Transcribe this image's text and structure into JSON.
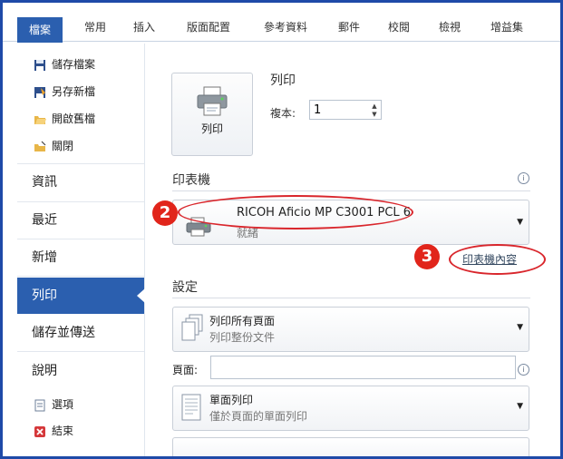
{
  "tabs": [
    "檔案",
    "常用",
    "插入",
    "版面配置",
    "參考資料",
    "郵件",
    "校閱",
    "檢視",
    "增益集"
  ],
  "sidebar": {
    "top_items": [
      "儲存檔案",
      "另存新檔",
      "開啟舊檔",
      "關閉"
    ],
    "big_items": [
      "資訊",
      "最近",
      "新增",
      "列印",
      "儲存並傳送",
      "說明"
    ],
    "bottom_items": [
      "選項",
      "結束"
    ]
  },
  "print": {
    "button_label": "列印",
    "heading": "列印",
    "copies_label": "複本:",
    "copies_value": "1"
  },
  "printer": {
    "section_title": "印表機",
    "name": "RICOH Aficio MP C3001 PCL 6",
    "status": "就緒",
    "properties_link": "印表機內容",
    "info_icon": "i"
  },
  "settings": {
    "section_title": "設定",
    "range_main": "列印所有頁面",
    "range_sub": "列印整份文件",
    "pages_label": "頁面:",
    "sides_main": "單面列印",
    "sides_sub": "僅於頁面的單面列印",
    "info_icon": "i"
  },
  "annotations": {
    "badge2": "2",
    "badge3": "3"
  },
  "colors": {
    "accent": "#2b5faf",
    "frame": "#1f4aa8",
    "highlight": "#d9262c"
  }
}
